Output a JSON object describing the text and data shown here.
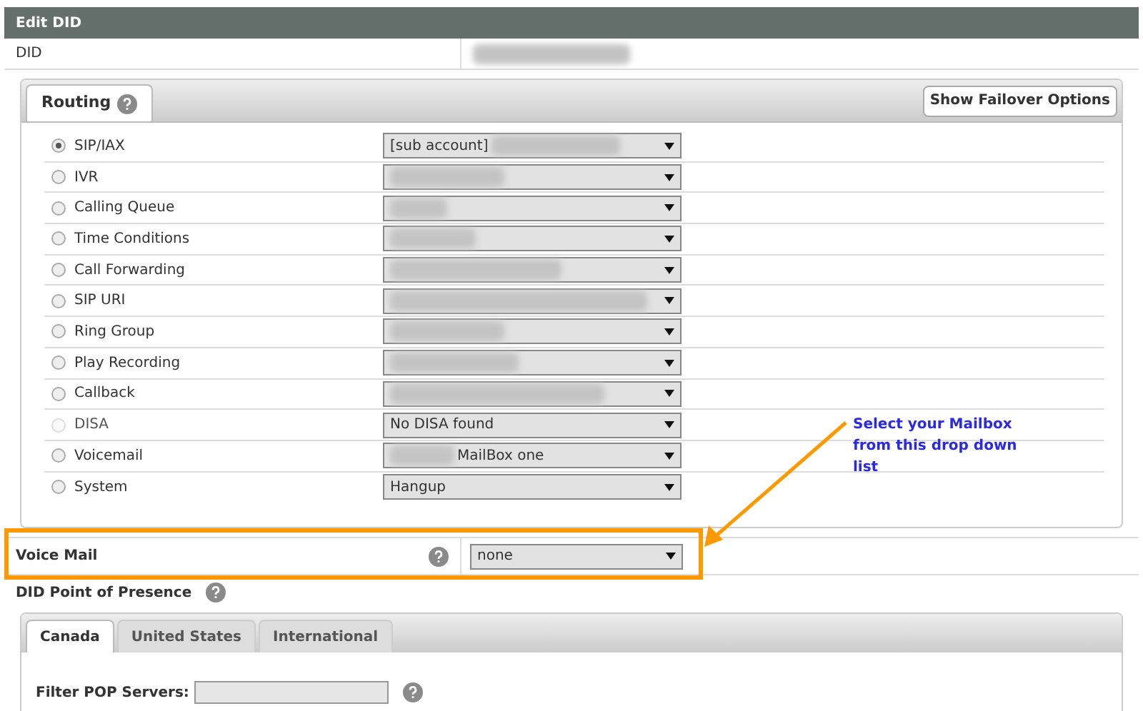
{
  "title": "Edit DID",
  "did": {
    "label": "DID"
  },
  "routing": {
    "tab": "Routing",
    "button": "Show Failover Options",
    "options": [
      {
        "label": "SIP/IAX",
        "selected": true,
        "disabled": false,
        "value": "[sub account]",
        "kind": "suffixblurred"
      },
      {
        "label": "IVR",
        "selected": false,
        "disabled": false,
        "kind": "blurred"
      },
      {
        "label": "Calling Queue",
        "selected": false,
        "disabled": false,
        "kind": "blurred"
      },
      {
        "label": "Time Conditions",
        "selected": false,
        "disabled": false,
        "kind": "blurred"
      },
      {
        "label": "Call Forwarding",
        "selected": false,
        "disabled": false,
        "kind": "blurred"
      },
      {
        "label": "SIP URI",
        "selected": false,
        "disabled": false,
        "kind": "blurred"
      },
      {
        "label": "Ring Group",
        "selected": false,
        "disabled": false,
        "kind": "blurred"
      },
      {
        "label": "Play Recording",
        "selected": false,
        "disabled": false,
        "kind": "blurred"
      },
      {
        "label": "Callback",
        "selected": false,
        "disabled": false,
        "kind": "blurred"
      },
      {
        "label": "DISA",
        "selected": false,
        "disabled": true,
        "value": "No DISA found",
        "kind": "plain"
      },
      {
        "label": "Voicemail",
        "selected": false,
        "disabled": false,
        "value": "MailBox one",
        "kind": "prefixblurred"
      },
      {
        "label": "System",
        "selected": false,
        "disabled": false,
        "value": "Hangup",
        "kind": "plain"
      }
    ]
  },
  "voice_mail": {
    "label": "Voice Mail",
    "value": "none"
  },
  "annotation": "Select your Mailbox from this drop down list",
  "pop": {
    "label": "DID Point of Presence",
    "tabs": [
      {
        "label": "Canada",
        "selected": true
      },
      {
        "label": "United States",
        "selected": false
      },
      {
        "label": "International",
        "selected": false
      }
    ],
    "filter_label": "Filter POP Servers:"
  }
}
